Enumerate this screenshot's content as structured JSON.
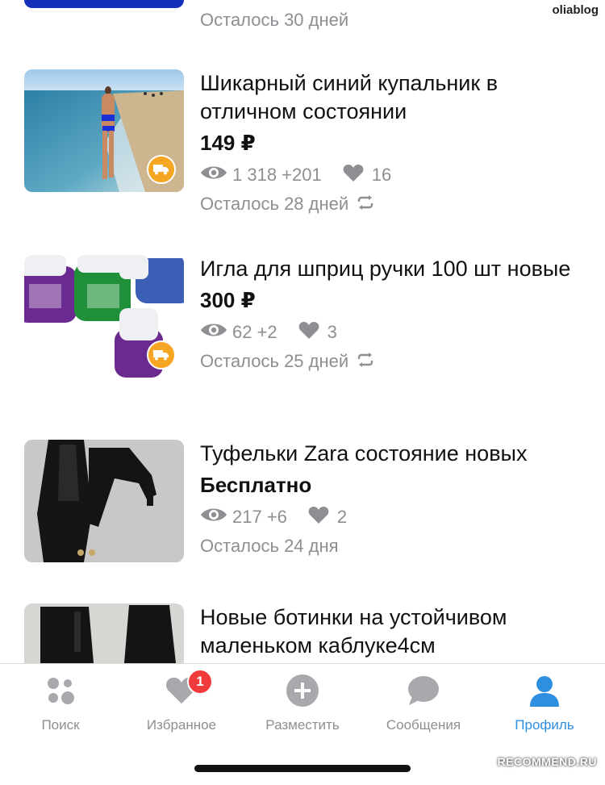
{
  "watermark": "oliablog",
  "previous_item": {
    "remaining": "Осталось 30 дней"
  },
  "listings": [
    {
      "title": "Шикарный синий купальник в отличном состоянии",
      "price": "149 ₽",
      "views": "1 318 +201",
      "likes": "16",
      "remaining": "Осталось 28 дней",
      "delivery_icon": "truck-icon",
      "auto_renew_icon": "repeat-icon"
    },
    {
      "title": "Игла для шприц ручки 100 шт новые",
      "price": "300 ₽",
      "views": "62 +2",
      "likes": "3",
      "remaining": "Осталось 25 дней",
      "delivery_icon": "truck-icon",
      "auto_renew_icon": "repeat-icon"
    },
    {
      "title": "Туфельки Zara состояние новых",
      "price": "Бесплатно",
      "views": "217 +6",
      "likes": "2",
      "remaining": "Осталось 24 дня"
    },
    {
      "title": "Новые ботинки на устойчивом маленьком каблуке4см"
    }
  ],
  "tabbar": {
    "tabs": [
      {
        "label": "Поиск",
        "icon": "search-dots-icon"
      },
      {
        "label": "Избранное",
        "icon": "heart-icon",
        "badge": "1"
      },
      {
        "label": "Разместить",
        "icon": "plus-circle-icon"
      },
      {
        "label": "Сообщения",
        "icon": "chat-bubble-icon"
      },
      {
        "label": "Профиль",
        "icon": "person-icon",
        "active": true
      }
    ]
  },
  "colors": {
    "accent": "#2e8fe0",
    "badge": "#ef3b3b",
    "delivery": "#f6a623",
    "muted": "#8e8e93"
  },
  "site_watermark": "RECOMMEND.RU"
}
